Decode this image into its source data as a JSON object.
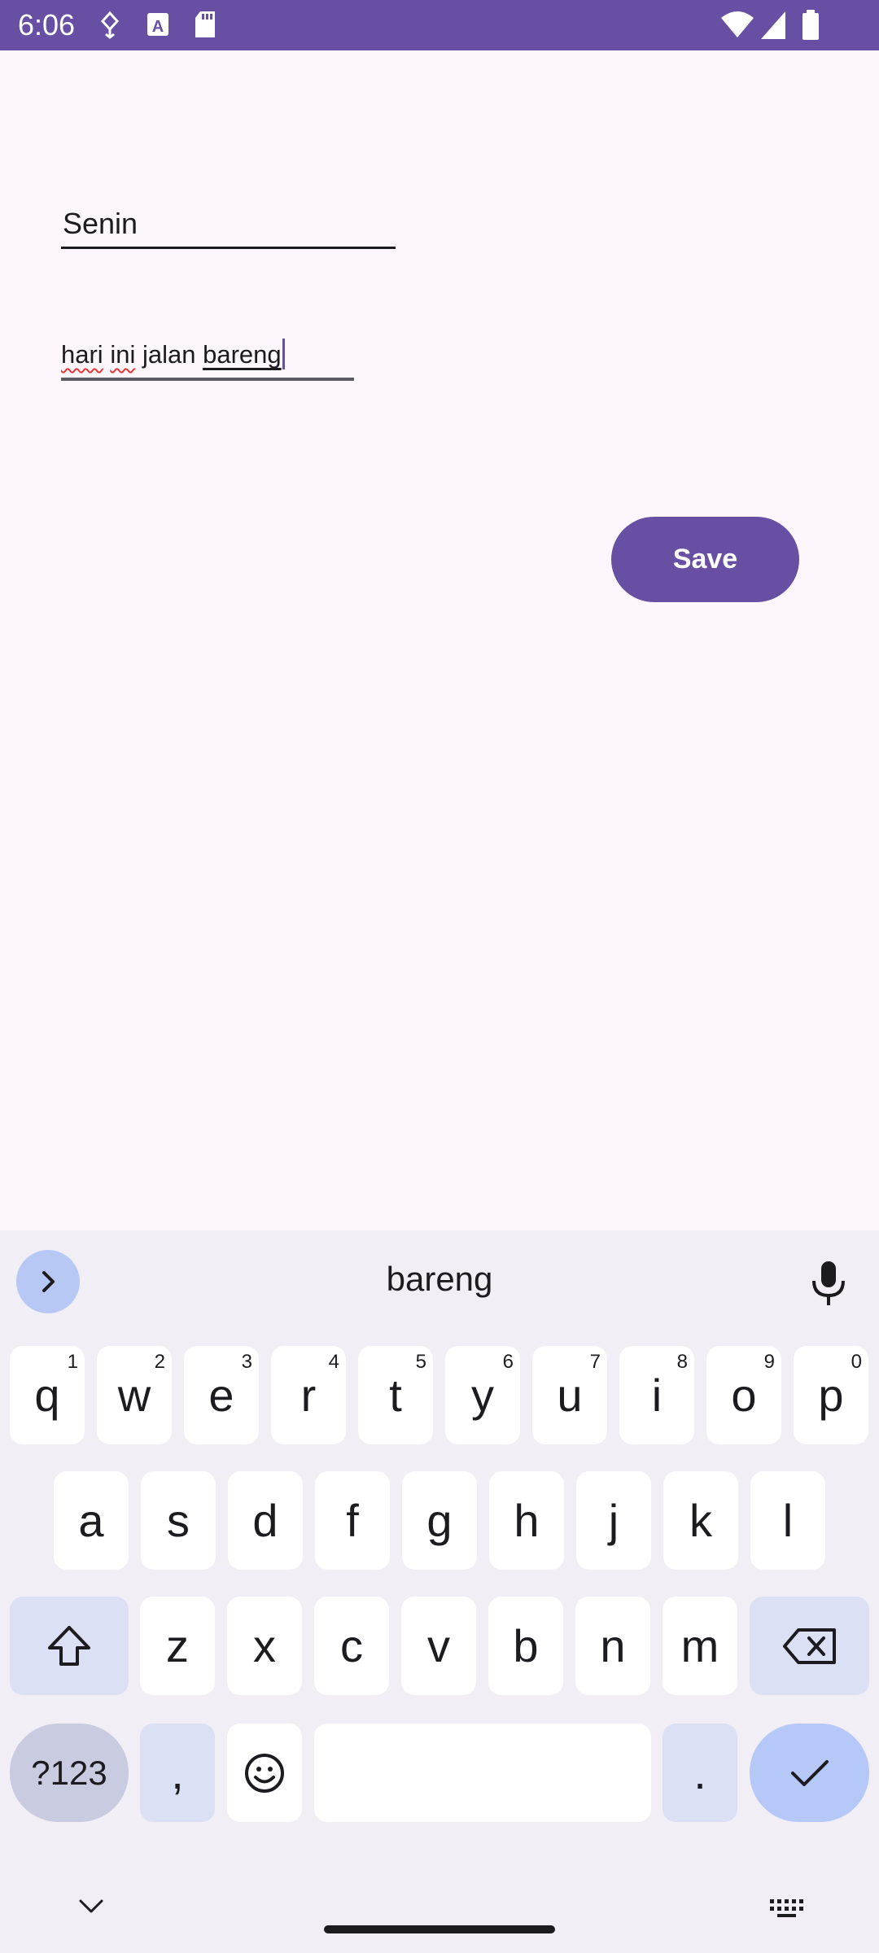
{
  "status_bar": {
    "time": "6:06",
    "icons": [
      "data-saver-icon",
      "text-app-icon",
      "sd-card-icon",
      "wifi-icon",
      "signal-icon",
      "battery-icon"
    ]
  },
  "form": {
    "day_field_value": "Senin",
    "note_text": {
      "w1": "hari",
      "w2": "ini",
      "w3": "jalan",
      "w4": "bareng"
    },
    "save_label": "Save"
  },
  "keyboard": {
    "suggestion": "bareng",
    "row1": [
      {
        "k": "q",
        "h": "1"
      },
      {
        "k": "w",
        "h": "2"
      },
      {
        "k": "e",
        "h": "3"
      },
      {
        "k": "r",
        "h": "4"
      },
      {
        "k": "t",
        "h": "5"
      },
      {
        "k": "y",
        "h": "6"
      },
      {
        "k": "u",
        "h": "7"
      },
      {
        "k": "i",
        "h": "8"
      },
      {
        "k": "o",
        "h": "9"
      },
      {
        "k": "p",
        "h": "0"
      }
    ],
    "row2": [
      "a",
      "s",
      "d",
      "f",
      "g",
      "h",
      "j",
      "k",
      "l"
    ],
    "row3": [
      "z",
      "x",
      "c",
      "v",
      "b",
      "n",
      "m"
    ],
    "symbols_label": "?123",
    "comma": ",",
    "period": "."
  },
  "colors": {
    "primary": "#6750a4",
    "background": "#fdf7fd",
    "keyboard_bg": "#f1eff5",
    "accent_key": "#b6c8f7"
  }
}
